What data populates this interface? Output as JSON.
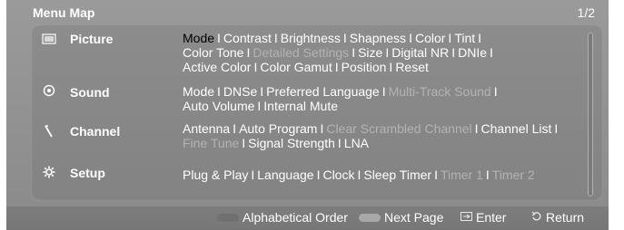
{
  "header": {
    "title": "Menu Map",
    "page": "1/2"
  },
  "menu": [
    {
      "label": "Picture",
      "icon": "picture-icon",
      "lines": [
        [
          {
            "text": "Mode",
            "state": "selected"
          },
          {
            "text": "Contrast",
            "state": "normal"
          },
          {
            "text": "Brightness",
            "state": "normal"
          },
          {
            "text": "Shapness",
            "state": "normal"
          },
          {
            "text": "Color",
            "state": "normal"
          },
          {
            "text": "Tint",
            "state": "normal"
          }
        ],
        [
          {
            "text": "Color Tone",
            "state": "normal"
          },
          {
            "text": "Detailed Settings",
            "state": "disabled"
          },
          {
            "text": "Size",
            "state": "normal"
          },
          {
            "text": "Digital NR",
            "state": "normal"
          },
          {
            "text": "DNIe",
            "state": "normal"
          }
        ],
        [
          {
            "text": "Active Color",
            "state": "normal"
          },
          {
            "text": "Color Gamut",
            "state": "normal"
          },
          {
            "text": "Position",
            "state": "normal"
          },
          {
            "text": "Reset",
            "state": "normal"
          }
        ]
      ]
    },
    {
      "label": "Sound",
      "icon": "sound-icon",
      "lines": [
        [
          {
            "text": "Mode",
            "state": "normal"
          },
          {
            "text": "DNSe",
            "state": "normal"
          },
          {
            "text": "Preferred Language",
            "state": "normal"
          },
          {
            "text": "Multi-Track Sound",
            "state": "disabled"
          }
        ],
        [
          {
            "text": "Auto Volume",
            "state": "normal"
          },
          {
            "text": "Internal Mute",
            "state": "normal"
          }
        ]
      ]
    },
    {
      "label": "Channel",
      "icon": "channel-icon",
      "lines": [
        [
          {
            "text": "Antenna",
            "state": "normal"
          },
          {
            "text": "Auto Program",
            "state": "normal"
          },
          {
            "text": "Clear Scrambled Channel",
            "state": "disabled"
          },
          {
            "text": "Channel List",
            "state": "normal"
          }
        ],
        [
          {
            "text": "Fine Tune",
            "state": "disabled"
          },
          {
            "text": "Signal Strength",
            "state": "normal"
          },
          {
            "text": "LNA",
            "state": "normal"
          }
        ]
      ]
    },
    {
      "label": "Setup",
      "icon": "setup-icon",
      "lines": [
        [
          {
            "text": "Plug & Play",
            "state": "normal"
          },
          {
            "text": "Language",
            "state": "normal"
          },
          {
            "text": "Clock",
            "state": "normal"
          },
          {
            "text": "Sleep Timer",
            "state": "normal"
          },
          {
            "text": "Timer 1",
            "state": "disabled"
          },
          {
            "text": "Timer 2",
            "state": "disabled"
          }
        ]
      ]
    }
  ],
  "separator": "I",
  "footer": {
    "alphabetical": {
      "label": "Alphabetical Order",
      "color": "#7a7a7a"
    },
    "next_page": {
      "label": "Next Page",
      "color": "#9c9c9c"
    },
    "enter": {
      "label": "Enter",
      "icon": "enter-icon"
    },
    "return": {
      "label": "Return",
      "icon": "return-icon"
    }
  }
}
